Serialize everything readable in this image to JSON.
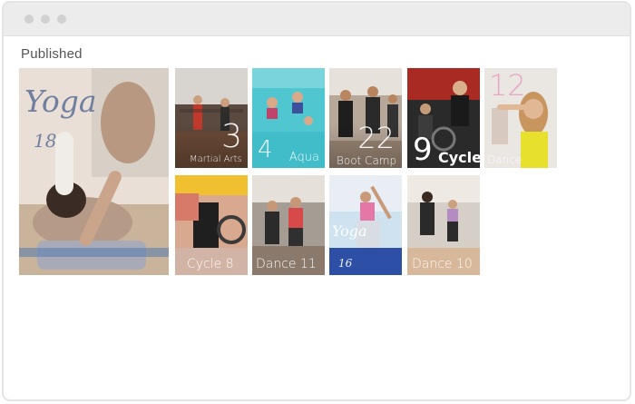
{
  "window": {
    "controls": [
      "close",
      "minimize",
      "maximize"
    ]
  },
  "section": {
    "title": "Published"
  },
  "tiles": {
    "yoga_large": {
      "script_title": "Yoga",
      "number": "18"
    },
    "martial_arts": {
      "number": "3",
      "label": "Martial Arts"
    },
    "aqua": {
      "number": "4",
      "label": "Aqua"
    },
    "boot_camp": {
      "number": "22",
      "label": "Boot Camp"
    },
    "cycle": {
      "number": "9",
      "label": "Cycle"
    },
    "dance_12": {
      "number": "12",
      "label": "Dance"
    },
    "cycle_8": {
      "label": "Cycle 8"
    },
    "dance_11": {
      "label": "Dance 11"
    },
    "yoga_small": {
      "script_title": "Yoga",
      "number": "16"
    },
    "dance_10": {
      "label": "Dance 10"
    }
  },
  "colors": {
    "titlebar": "#ececec",
    "window_dot": "#d1d1d1",
    "dance_number": "#e8a6c4"
  }
}
